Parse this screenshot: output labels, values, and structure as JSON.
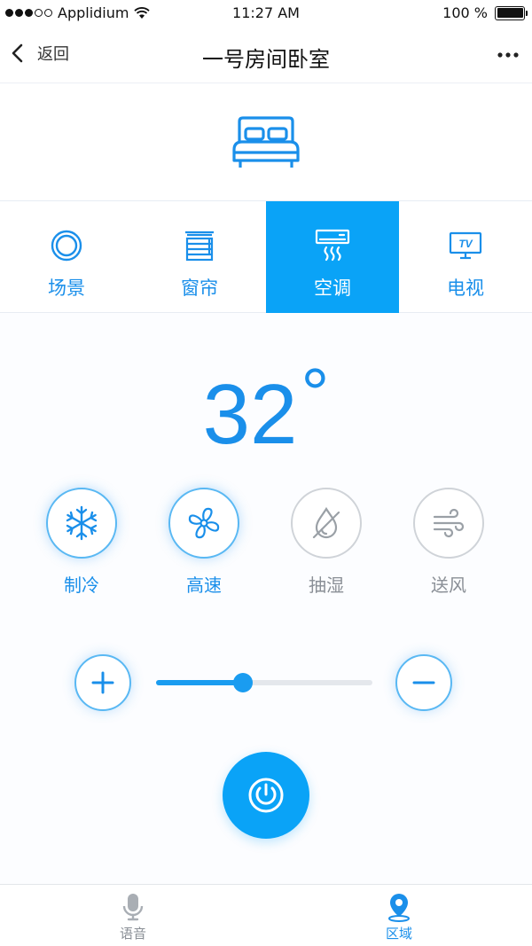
{
  "status_bar": {
    "carrier": "Applidium",
    "time": "11:27 AM",
    "battery": "100 %",
    "battery_level": 1.0
  },
  "nav": {
    "back_label": "返回",
    "title": "一号房间卧室"
  },
  "tabs": [
    {
      "label": "场景",
      "icon": "scene-ring-icon",
      "active": false
    },
    {
      "label": "窗帘",
      "icon": "curtain-icon",
      "active": false
    },
    {
      "label": "空调",
      "icon": "air-conditioner-icon",
      "active": true
    },
    {
      "label": "电视",
      "icon": "tv-icon",
      "active": false
    }
  ],
  "tv_icon_text": "TV",
  "temperature": {
    "value": "32",
    "unit": "°"
  },
  "modes": [
    {
      "label": "制冷",
      "icon": "snowflake-icon",
      "active": true
    },
    {
      "label": "高速",
      "icon": "fan-icon",
      "active": true
    },
    {
      "label": "抽湿",
      "icon": "dehumidify-icon",
      "active": false
    },
    {
      "label": "送风",
      "icon": "wind-icon",
      "active": false
    }
  ],
  "slider": {
    "value_fraction": 0.4
  },
  "bottom_tabs": [
    {
      "label": "语音",
      "icon": "microphone-icon",
      "active": false
    },
    {
      "label": "区域",
      "icon": "location-pin-icon",
      "active": true
    }
  ],
  "colors": {
    "accent": "#0aa3f7",
    "text_accent": "#1a8fea",
    "inactive": "#8a8f96"
  }
}
